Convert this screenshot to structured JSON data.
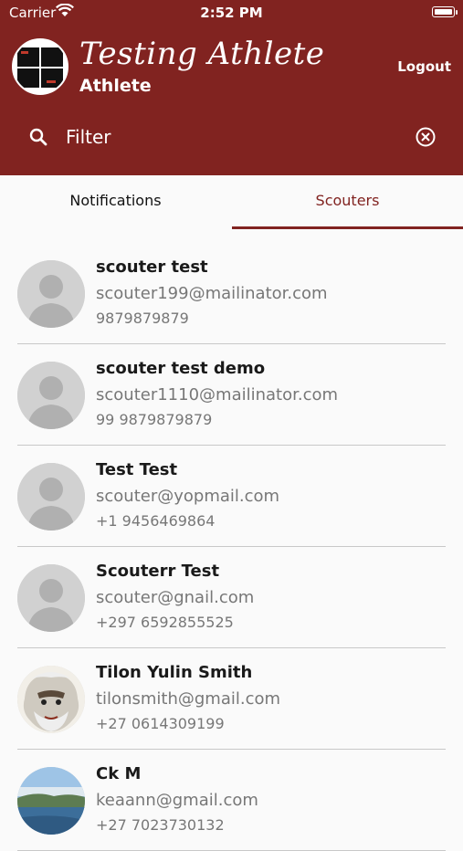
{
  "status": {
    "carrier": "Carrier",
    "time": "2:52 PM"
  },
  "profile": {
    "name": "Testing  Athlete",
    "role": "Athlete"
  },
  "header": {
    "logout_label": "Logout"
  },
  "filter": {
    "placeholder": "Filter",
    "value": ""
  },
  "tabs": [
    {
      "label": "Notifications"
    },
    {
      "label": "Scouters"
    }
  ],
  "scouters": [
    {
      "name": "scouter test",
      "email": "scouter199@mailinator.com",
      "phone": "9879879879",
      "avatar": "placeholder"
    },
    {
      "name": "scouter test demo",
      "email": "scouter1110@mailinator.com",
      "phone": "99 9879879879",
      "avatar": "placeholder"
    },
    {
      "name": "Test Test",
      "email": "scouter@yopmail.com",
      "phone": "+1 9456469864",
      "avatar": "placeholder"
    },
    {
      "name": "Scouterr Test",
      "email": "scouter@gnail.com",
      "phone": "+297 6592855525",
      "avatar": "placeholder"
    },
    {
      "name": "Tilon Yulin Smith",
      "email": "tilonsmith@gmail.com",
      "phone": "+27 0614309199",
      "avatar": "illustration"
    },
    {
      "name": "Ck M",
      "email": "keaann@gmail.com",
      "phone": "+27 7023730132",
      "avatar": "landscape-photo"
    }
  ],
  "colors": {
    "brand": "#812320",
    "divider": "#c8c8c8",
    "secondary_text": "#777777",
    "avatar_placeholder": "#d1d1d1"
  }
}
